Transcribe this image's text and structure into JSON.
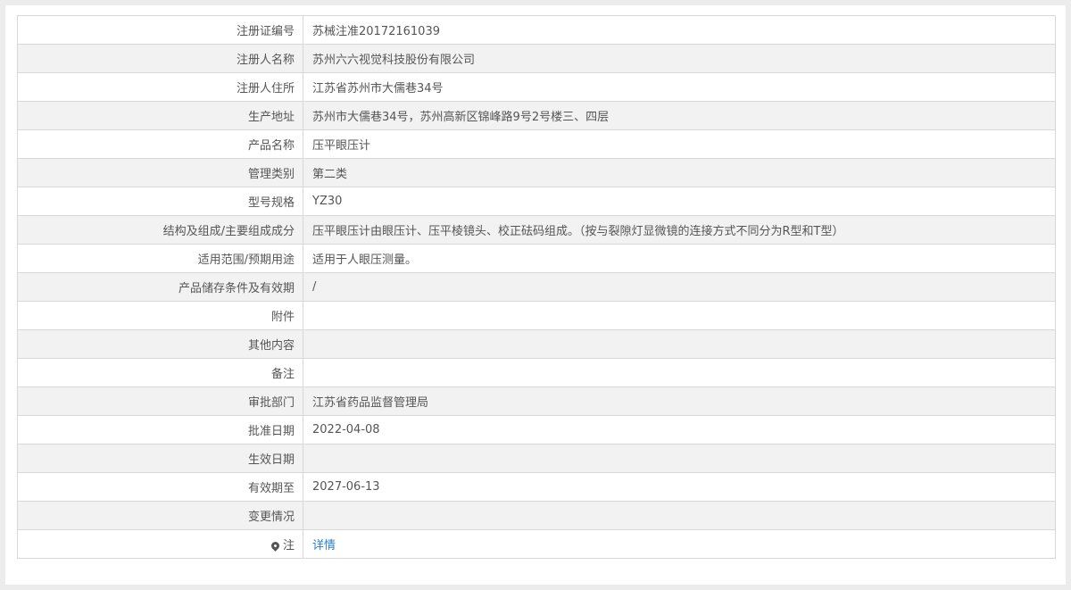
{
  "rows": [
    {
      "label": "注册证编号",
      "value": "苏械注准20172161039"
    },
    {
      "label": "注册人名称",
      "value": "苏州六六视觉科技股份有限公司"
    },
    {
      "label": "注册人住所",
      "value": "江苏省苏州市大儒巷34号"
    },
    {
      "label": "生产地址",
      "value": "苏州市大儒巷34号，苏州高新区锦峰路9号2号楼三、四层"
    },
    {
      "label": "产品名称",
      "value": "压平眼压计"
    },
    {
      "label": "管理类别",
      "value": "第二类"
    },
    {
      "label": "型号规格",
      "value": "YZ30"
    },
    {
      "label": "结构及组成/主要组成成分",
      "value": "压平眼压计由眼压计、压平棱镜头、校正砝码组成。（按与裂隙灯显微镜的连接方式不同分为R型和T型）"
    },
    {
      "label": "适用范围/预期用途",
      "value": "适用于人眼压测量。"
    },
    {
      "label": "产品储存条件及有效期",
      "value": "/"
    },
    {
      "label": "附件",
      "value": ""
    },
    {
      "label": "其他内容",
      "value": ""
    },
    {
      "label": "备注",
      "value": ""
    },
    {
      "label": "审批部门",
      "value": "江苏省药品监督管理局"
    },
    {
      "label": "批准日期",
      "value": "2022-04-08"
    },
    {
      "label": "生效日期",
      "value": ""
    },
    {
      "label": "有效期至",
      "value": "2027-06-13"
    },
    {
      "label": "变更情况",
      "value": ""
    }
  ],
  "note": {
    "icon": "pin-icon",
    "label": "注",
    "link_text": "详情"
  },
  "colors": {
    "label_text": "#555555",
    "link": "#2a7fc9",
    "border": "#d8d8d8",
    "stripe": "#f2f2f2"
  }
}
